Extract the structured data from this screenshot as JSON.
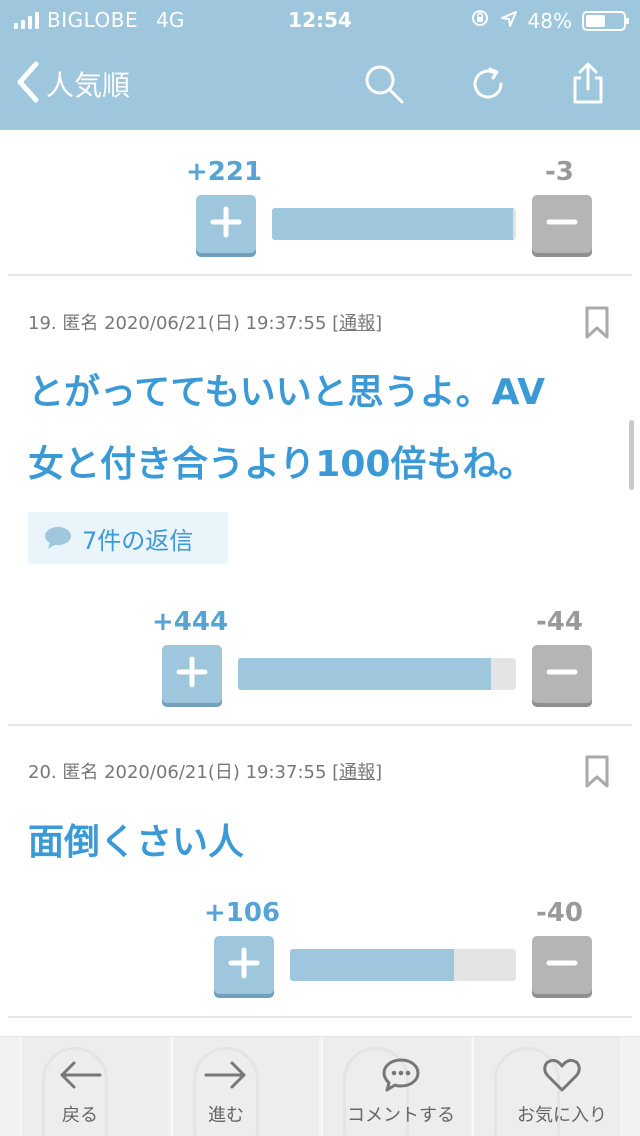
{
  "status_bar": {
    "carrier": "BIGLOBE",
    "network": "4G",
    "time": "12:54",
    "battery": "48%"
  },
  "nav": {
    "title": "人気順",
    "icons": [
      "chevron-left-icon",
      "search-icon",
      "refresh-icon",
      "share-icon"
    ]
  },
  "comments": [
    {
      "plus": "+221",
      "minus": "-3",
      "ratio": 0.987
    },
    {
      "meta_prefix": "19. 匿名 2020/06/21(日) 19:37:55 ",
      "report": "[通報]",
      "body_line1": "とがっててもいいと思うよ。AV",
      "body_line2": "女と付き合うより100倍もね。",
      "replies": "7件の返信",
      "plus": "+444",
      "minus": "-44",
      "ratio": 0.91
    },
    {
      "meta_prefix": "20. 匿名 2020/06/21(日) 19:37:55 ",
      "report": "[通報]",
      "body": "面倒くさい人",
      "plus": "+106",
      "minus": "-40",
      "ratio": 0.726
    }
  ],
  "colors": {
    "accent": "#9ec6dd",
    "text_blue": "#3b9ad6",
    "minus_gray": "#b5b5b5"
  },
  "toolbar": {
    "back": "戻る",
    "forward": "進む",
    "comment": "コメントする",
    "favorite": "お気に入り"
  }
}
